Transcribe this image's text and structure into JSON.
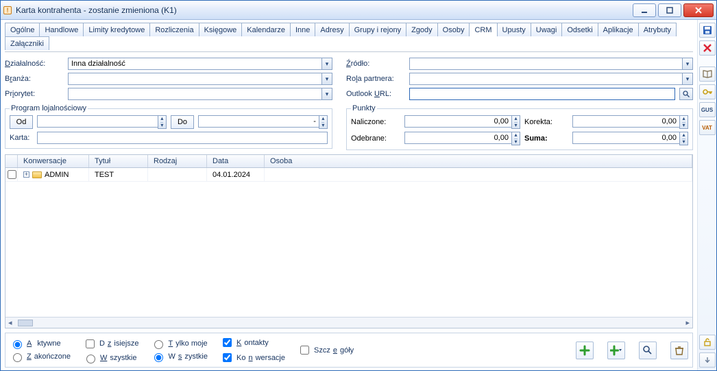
{
  "window": {
    "title": "Karta kontrahenta - zostanie zmieniona (K1)"
  },
  "tabs": [
    "Ogólne",
    "Handlowe",
    "Limity kredytowe",
    "Rozliczenia",
    "Księgowe",
    "Kalendarze",
    "Inne",
    "Adresy",
    "Grupy i rejony",
    "Zgody",
    "Osoby",
    "CRM",
    "Upusty",
    "Uwagi",
    "Odsetki",
    "Aplikacje",
    "Atrybuty",
    "Załączniki"
  ],
  "activeTab": "CRM",
  "left": {
    "activity_label": "Działalność:",
    "activity_value": "Inna działalność",
    "industry_label": "Branża:",
    "industry_value": "",
    "priority_label": "Priorytet:",
    "priority_value": "",
    "loyalty_legend": "Program lojalnościowy",
    "from_label": "Od",
    "from_value": "",
    "to_label": "Do",
    "to_value": "-",
    "card_label": "Karta:",
    "card_value": ""
  },
  "right": {
    "source_label": "Źródło:",
    "source_value": "",
    "role_label": "Rola partnera:",
    "role_value": "",
    "outlook_label": "Outlook URL:",
    "outlook_value": "",
    "points_legend": "Punkty",
    "calc_label": "Naliczone:",
    "calc_value": "0,00",
    "recv_label": "Odebrane:",
    "recv_value": "0,00",
    "corr_label": "Korekta:",
    "corr_value": "0,00",
    "sum_label": "Suma:",
    "sum_value": "0,00"
  },
  "table": {
    "headers": {
      "conv": "Konwersacje",
      "title": "Tytuł",
      "kind": "Rodzaj",
      "date": "Data",
      "person": "Osoba"
    },
    "rows": [
      {
        "conv": "ADMIN",
        "title": "TEST",
        "kind": "",
        "date": "04.01.2024",
        "person": ""
      }
    ]
  },
  "filters": {
    "active": "Aktywne",
    "finished": "Zakończone",
    "today": "Dzisiejsze",
    "all1": "Wszystkie",
    "mine": "Tylko moje",
    "all2": "Wszystkie",
    "contacts": "Kontakty",
    "conversations": "Konwersacje",
    "details": "Szczegóły"
  }
}
